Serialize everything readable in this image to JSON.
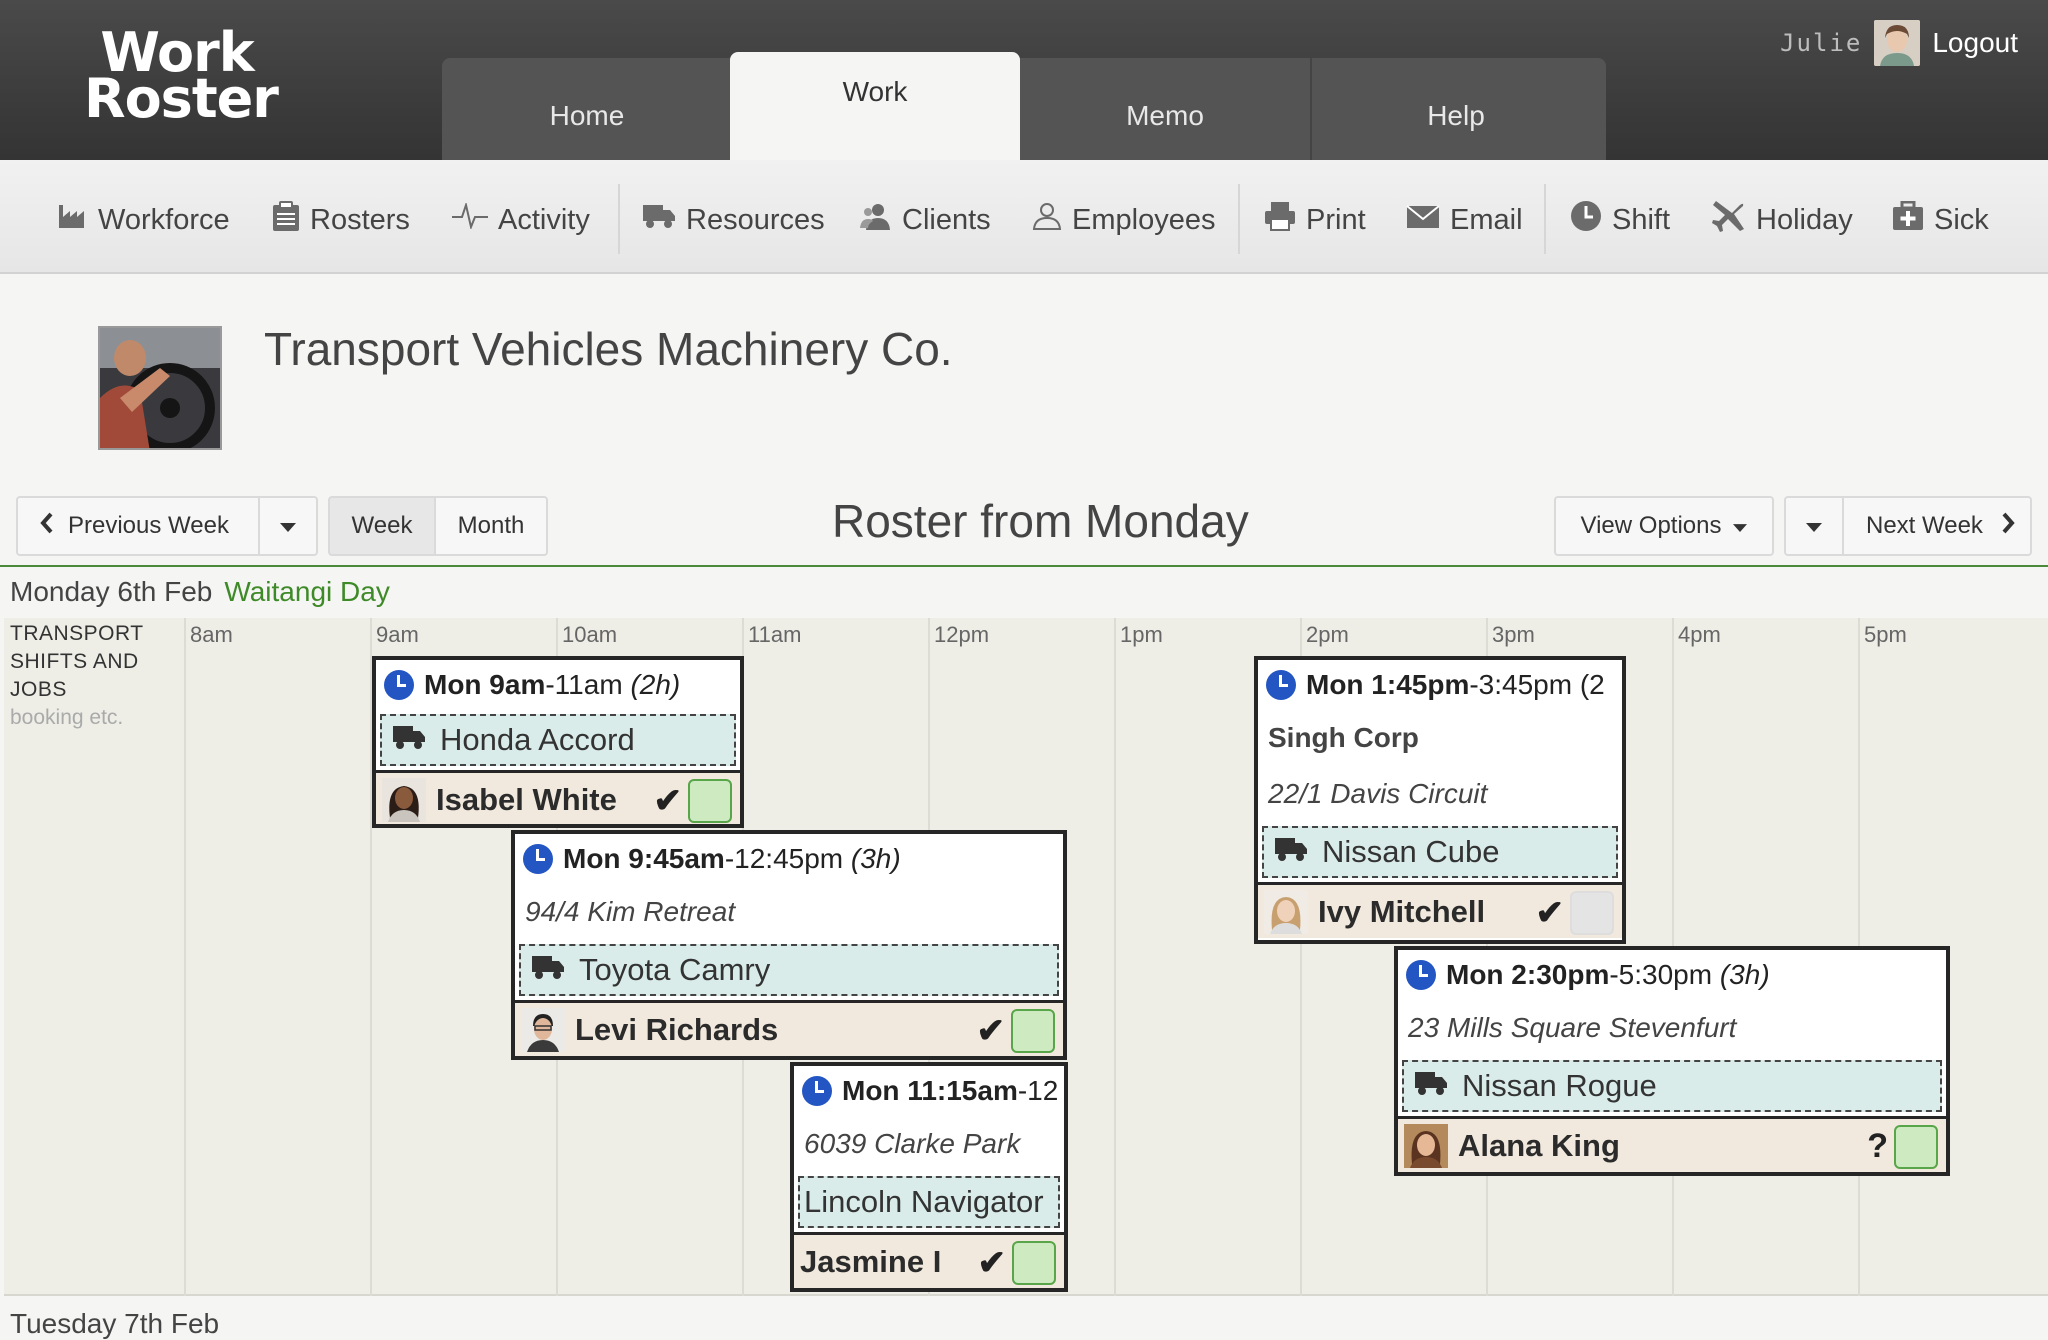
{
  "app": {
    "logo_line1": "Work",
    "logo_line2": "Roster"
  },
  "main_tabs": [
    {
      "label": "Home"
    },
    {
      "label": "Work",
      "active": true
    },
    {
      "label": "Memo"
    },
    {
      "label": "Help"
    }
  ],
  "user": {
    "name": "Julie",
    "logout_label": "Logout"
  },
  "toolbar": [
    {
      "label": "Workforce",
      "icon": "factory-icon"
    },
    {
      "label": "Rosters",
      "icon": "clipboard-icon"
    },
    {
      "label": "Activity",
      "icon": "pulse-icon"
    },
    {
      "label": "Resources",
      "icon": "truck-icon"
    },
    {
      "label": "Clients",
      "icon": "clients-icon"
    },
    {
      "label": "Employees",
      "icon": "person-icon"
    },
    {
      "label": "Print",
      "icon": "printer-icon"
    },
    {
      "label": "Email",
      "icon": "envelope-icon"
    },
    {
      "label": "Shift",
      "icon": "clock-icon"
    },
    {
      "label": "Holiday",
      "icon": "plane-icon"
    },
    {
      "label": "Sick",
      "icon": "medkit-icon"
    }
  ],
  "client": {
    "name": "Transport Vehicles Machinery Co."
  },
  "controls": {
    "previous_week": "Previous Week",
    "week": "Week",
    "month": "Month",
    "title": "Roster from Monday",
    "view_options": "View Options",
    "next_week": "Next Week"
  },
  "day": {
    "label": "Monday 6th Feb",
    "holiday": "Waitangi Day",
    "row_label_lines": [
      "TRANSPORT",
      "SHIFTS AND",
      "JOBS"
    ],
    "row_sublabel": "booking etc.",
    "hours": [
      "8am",
      "9am",
      "10am",
      "11am",
      "12pm",
      "1pm",
      "2pm",
      "3pm",
      "4pm",
      "5pm"
    ]
  },
  "jobs": [
    {
      "start": "Mon 9am",
      "end": "-11am",
      "duration": "(2h)",
      "client": "",
      "address": "",
      "vehicle": "Honda Accord",
      "employee": "Isabel White",
      "status": "✔"
    },
    {
      "start": "Mon 9:45am",
      "end": "-12:45pm",
      "duration": "(3h)",
      "client": "",
      "address": "94/4 Kim Retreat",
      "vehicle": "Toyota Camry",
      "employee": "Levi Richards",
      "status": "✔"
    },
    {
      "start": "Mon 11:15am",
      "end": "-12",
      "duration": "",
      "client": "",
      "address": "6039 Clarke Park",
      "vehicle": "Lincoln Navigator",
      "employee": "Jasmine I",
      "status": "✔"
    },
    {
      "start": "Mon 1:45pm",
      "end": "-3:45pm",
      "duration": "(2",
      "client": "Singh Corp",
      "address": "22/1 Davis Circuit",
      "vehicle": "Nissan Cube",
      "employee": "Ivy Mitchell",
      "status": "✔"
    },
    {
      "start": "Mon 2:30pm",
      "end": "-5:30pm",
      "duration": "(3h)",
      "client": "",
      "address": "23 Mills Square Stevenfurt",
      "vehicle": "Nissan Rogue",
      "employee": "Alana King",
      "status": "?"
    }
  ],
  "next_day": {
    "label": "Tuesday 7th Feb"
  },
  "colors": {
    "accent_green": "#3f8a28",
    "clock_blue": "#2356c2",
    "vehicle_bg": "#d9ecea",
    "employee_bg": "#f1e9de"
  }
}
